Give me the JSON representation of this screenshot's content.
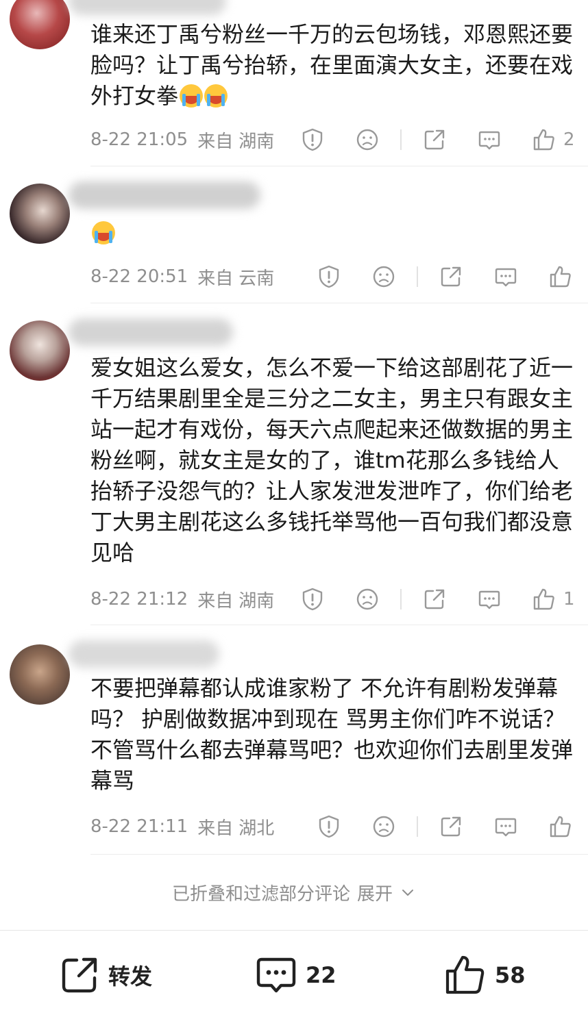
{
  "comments": [
    {
      "text": "谁来还丁禹兮粉丝一千万的云包场钱，邓恩熙还要脸吗？让丁禹兮抬轿，在里面演大女主，还要在戏外打女拳",
      "emoji_names": [
        "crying-face-emoji",
        "crying-face-emoji"
      ],
      "date": "8-22 21:05",
      "source_label": "来自",
      "location": "湖南",
      "like_count": "2"
    },
    {
      "text": "",
      "emoji_names": [
        "surprised-face-emoji"
      ],
      "date": "8-22 20:51",
      "source_label": "来自",
      "location": "云南",
      "like_count": ""
    },
    {
      "text": "爱女姐这么爱女，怎么不爱一下给这部剧花了近一千万结果剧里全是三分之二女主，男主只有跟女主站一起才有戏份，每天六点爬起来还做数据的男主粉丝啊，就女主是女的了，谁tm花那么多钱给人抬轿子没怨气的？让人家发泄发泄咋了，你们给老丁大男主剧花这么多钱托举骂他一百句我们都没意见哈",
      "emoji_names": [],
      "date": "8-22 21:12",
      "source_label": "来自",
      "location": "湖南",
      "like_count": "1"
    },
    {
      "text": "不要把弹幕都认成谁家粉了 不允许有剧粉发弹幕吗？ 护剧做数据冲到现在 骂男主你们咋不说话？ 不管骂什么都去弹幕骂吧？也欢迎你们去剧里发弹幕骂",
      "emoji_names": [],
      "date": "8-22 21:11",
      "source_label": "来自",
      "location": "湖北",
      "like_count": ""
    }
  ],
  "icons": {
    "report": "report-icon",
    "dislike": "dislike-face-icon",
    "share": "share-icon",
    "reply": "reply-comment-icon",
    "like": "thumbs-up-icon"
  },
  "folded": {
    "label": "已折叠和过滤部分评论",
    "expand": "展开"
  },
  "bottom_bar": {
    "repost_label": "转发",
    "comment_count": "22",
    "like_count": "58"
  },
  "colors": {
    "meta_text": "#8e8e8e",
    "icon_gray": "#999999",
    "bottom_text": "#222222"
  }
}
